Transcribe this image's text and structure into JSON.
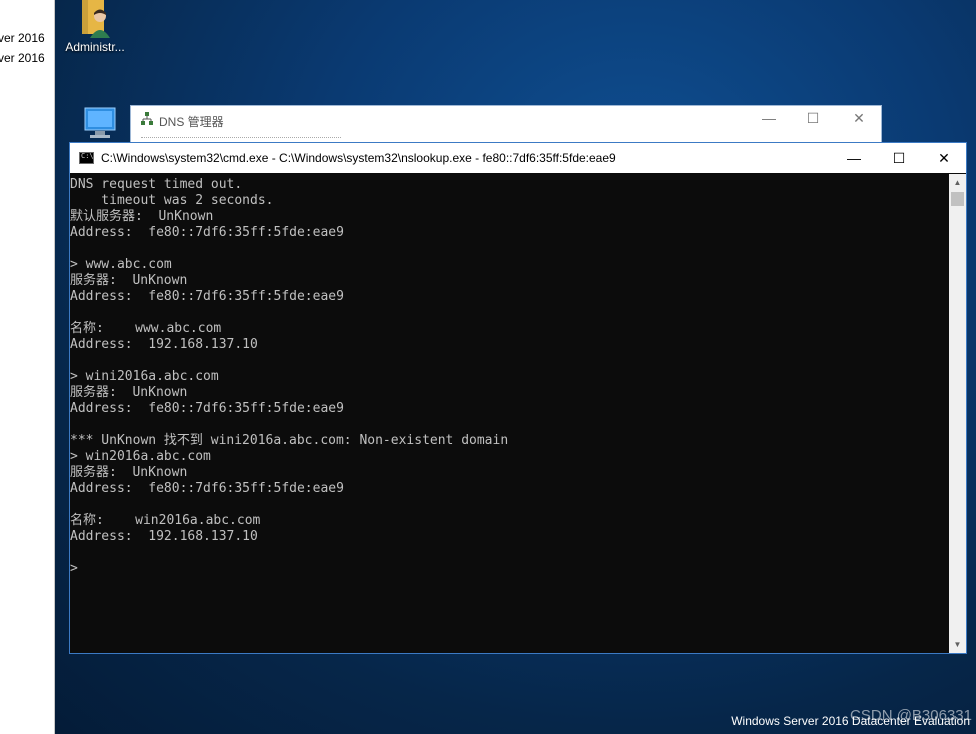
{
  "left_window": {
    "items": [
      "ver 2016",
      "ver 2016"
    ]
  },
  "desktop": {
    "admin_icon_label": "Administr...",
    "os_watermark": "Windows Server 2016 Datacenter Evaluation",
    "csdn_watermark": "CSDN @B306331"
  },
  "dns_window": {
    "title": "DNS 管理器"
  },
  "cmd_window": {
    "title": "C:\\Windows\\system32\\cmd.exe - C:\\Windows\\system32\\nslookup.exe  - fe80::7df6:35ff:5fde:eae9",
    "icon_text": "C:\\",
    "lines": [
      "DNS request timed out.",
      "    timeout was 2 seconds.",
      "默认服务器:  UnKnown",
      "Address:  fe80::7df6:35ff:5fde:eae9",
      "",
      "> www.abc.com",
      "服务器:  UnKnown",
      "Address:  fe80::7df6:35ff:5fde:eae9",
      "",
      "名称:    www.abc.com",
      "Address:  192.168.137.10",
      "",
      "> wini2016a.abc.com",
      "服务器:  UnKnown",
      "Address:  fe80::7df6:35ff:5fde:eae9",
      "",
      "*** UnKnown 找不到 wini2016a.abc.com: Non-existent domain",
      "> win2016a.abc.com",
      "服务器:  UnKnown",
      "Address:  fe80::7df6:35ff:5fde:eae9",
      "",
      "名称:    win2016a.abc.com",
      "Address:  192.168.137.10",
      "",
      ">"
    ],
    "buttons": {
      "minimize": "—",
      "maximize": "☐",
      "close": "✕"
    }
  },
  "colors": {
    "console_bg": "#0c0c0c",
    "console_text": "#c0c0c0",
    "window_border": "#3c7ac4"
  }
}
